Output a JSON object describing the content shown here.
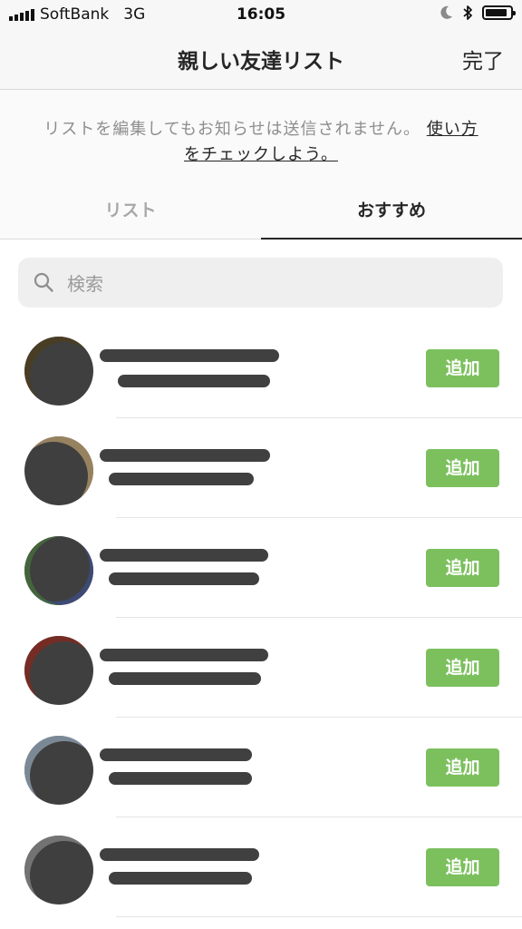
{
  "status_bar": {
    "carrier": "SoftBank",
    "network": "3G",
    "time": "16:05",
    "icons": [
      "signal-bars-icon",
      "moon-icon",
      "bluetooth-icon",
      "battery-icon"
    ],
    "battery_level": 0.9
  },
  "nav": {
    "title": "親しい友達リスト",
    "done_label": "完了"
  },
  "notice": {
    "text": "リストを編集してもお知らせは送信されません。",
    "link": "使い方をチェックしよう。"
  },
  "tabs": [
    {
      "label": "リスト",
      "active": false
    },
    {
      "label": "おすすめ",
      "active": true
    }
  ],
  "search": {
    "placeholder": "検索",
    "value": ""
  },
  "suggestions": [
    {
      "add_label": "追加"
    },
    {
      "add_label": "追加"
    },
    {
      "add_label": "追加"
    },
    {
      "add_label": "追加"
    },
    {
      "add_label": "追加"
    },
    {
      "add_label": "追加"
    }
  ],
  "colors": {
    "add_button": "#7cc05e",
    "redaction": "#404040",
    "bar_background": "#f7f7f7"
  }
}
